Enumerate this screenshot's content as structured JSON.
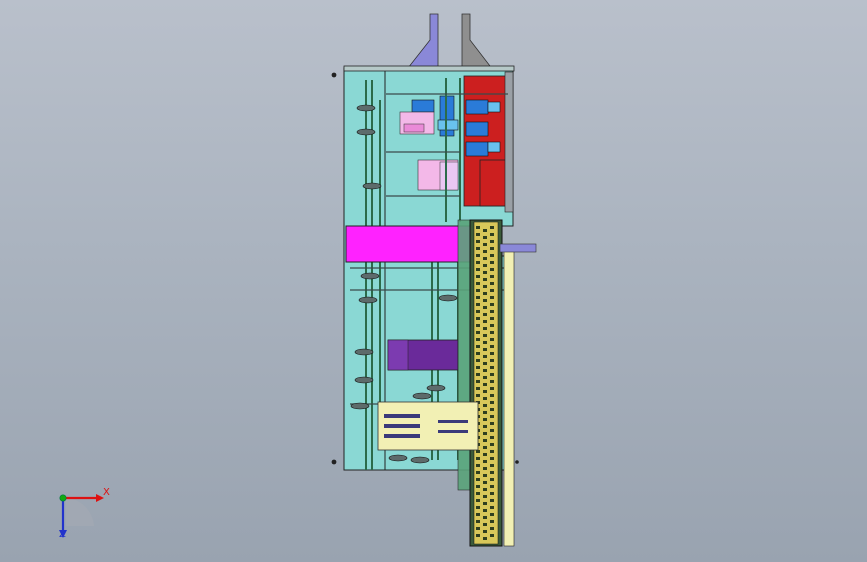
{
  "viewport": {
    "background_top": "#b9c0cb",
    "background_bottom": "#99a3b0"
  },
  "triad": {
    "x_label": "X",
    "z_label": "Z",
    "x_color": "#dd1111",
    "y_color": "#11aa11",
    "z_color": "#2233cc"
  },
  "model": {
    "panel_color": "#8ad8d4",
    "magenta_block_color": "#ff22ff",
    "purple_block_color": "#6a2a9a",
    "red_block_color": "#cc1f1f",
    "chain_color": "#d8c85a",
    "pale_yellow_color": "#f2f0b4",
    "blue_plate_color": "#8a88d8",
    "grey_plate_color": "#8f8f8f",
    "icons": [
      "coordinate-triad-icon"
    ]
  }
}
